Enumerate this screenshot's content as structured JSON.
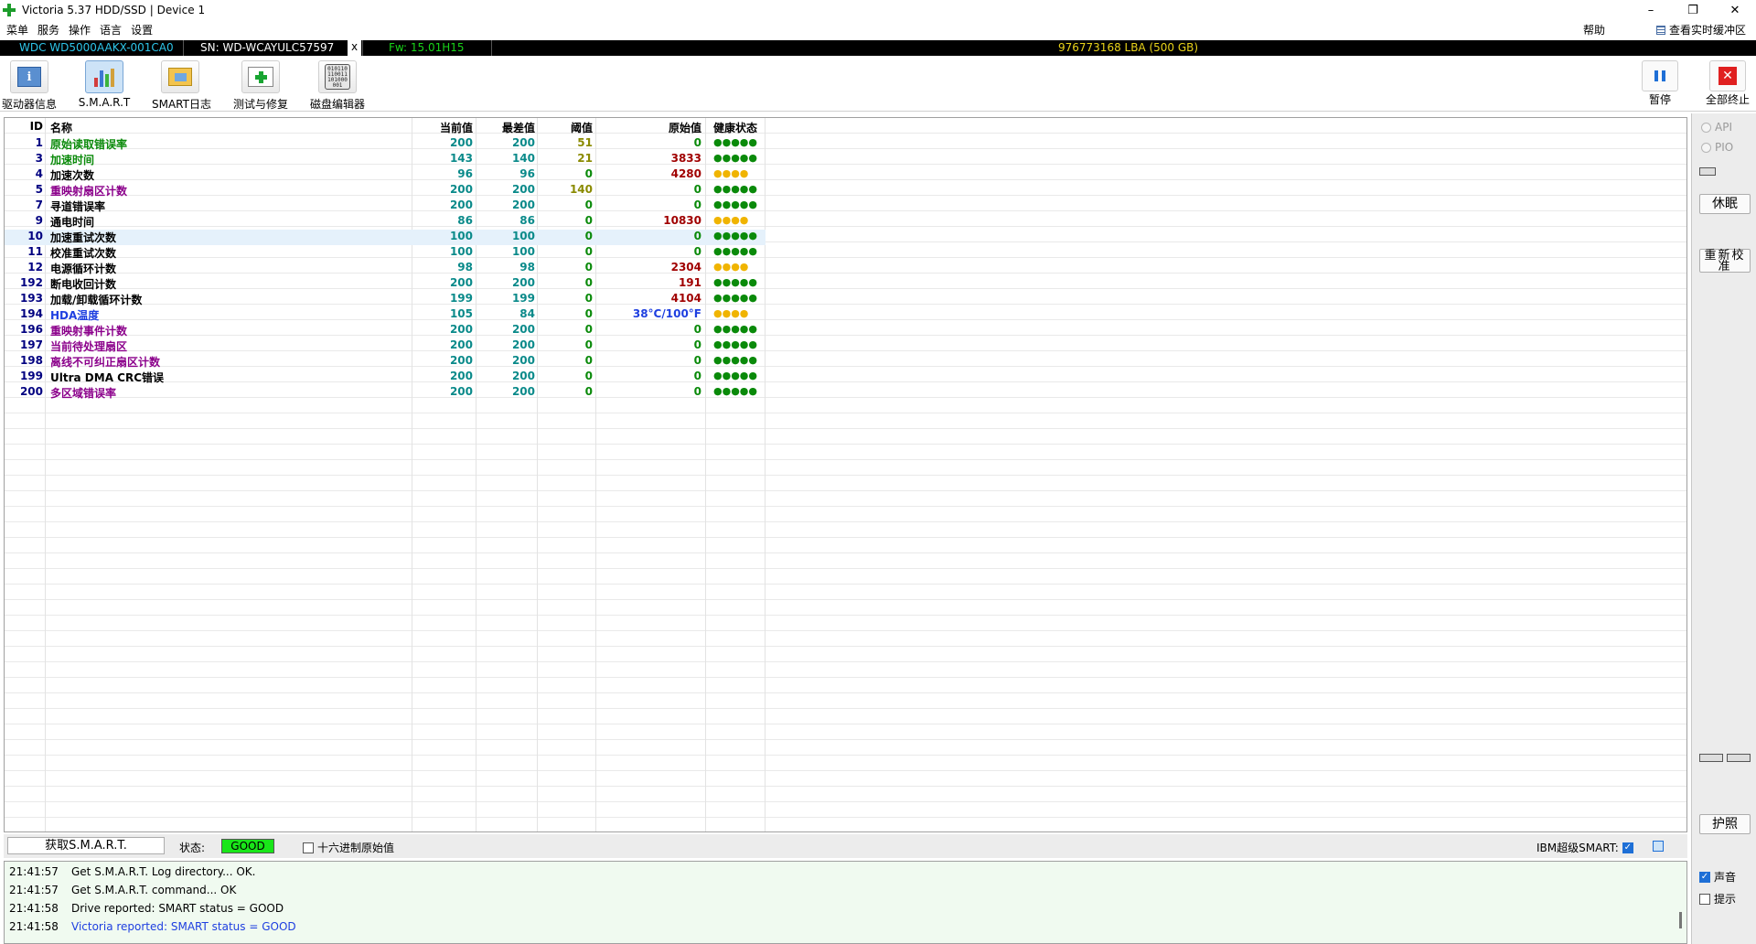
{
  "window": {
    "title": "Victoria 5.37 HDD/SSD | Device 1",
    "controls": [
      "–",
      "❐",
      "✕"
    ]
  },
  "menu": [
    "菜单",
    "服务",
    "操作",
    "语言",
    "设置"
  ],
  "help": "帮助",
  "buffer_link": "查看实时缓冲区",
  "device": {
    "model": "WDC WD5000AAKX-001CA0",
    "serial": "SN: WD-WCAYULC57597",
    "close": "x",
    "firmware": "Fw: 15.01H15",
    "capacity": "976773168 LBA (500 GB)"
  },
  "toolbar": {
    "drive_info": "驱动器信息",
    "smart": "S.M.A.R.T",
    "smart_log": "SMART日志",
    "test_repair": "测试与修复",
    "disk_editor": "磁盘编辑器",
    "disk_editor_icon_text": "010110 110011 101000 001",
    "info_icon_text": "i",
    "pause": "暂停",
    "stop_all": "全部终止",
    "stop_icon_text": "✕"
  },
  "table": {
    "headers": {
      "id": "ID",
      "name": "名称",
      "current": "当前值",
      "worst": "最差值",
      "threshold": "阈值",
      "raw": "原始值",
      "health": "健康状态"
    },
    "rows": [
      {
        "id": "1",
        "name": "原始读取错误率",
        "cur": "200",
        "worst": "200",
        "thr": "51",
        "raw": "0",
        "health": "●●●●●"
      },
      {
        "id": "3",
        "name": "加速时间",
        "cur": "143",
        "worst": "140",
        "thr": "21",
        "raw": "3833",
        "health": "●●●●●"
      },
      {
        "id": "4",
        "name": "加速次数",
        "cur": "96",
        "worst": "96",
        "thr": "0",
        "raw": "4280",
        "health": "●●●●"
      },
      {
        "id": "5",
        "name": "重映射扇区计数",
        "cur": "200",
        "worst": "200",
        "thr": "140",
        "raw": "0",
        "health": "●●●●●"
      },
      {
        "id": "7",
        "name": "寻道错误率",
        "cur": "200",
        "worst": "200",
        "thr": "0",
        "raw": "0",
        "health": "●●●●●"
      },
      {
        "id": "9",
        "name": "通电时间",
        "cur": "86",
        "worst": "86",
        "thr": "0",
        "raw": "10830",
        "health": "●●●●"
      },
      {
        "id": "10",
        "name": "加速重试次数",
        "cur": "100",
        "worst": "100",
        "thr": "0",
        "raw": "0",
        "health": "●●●●●"
      },
      {
        "id": "11",
        "name": "校准重试次数",
        "cur": "100",
        "worst": "100",
        "thr": "0",
        "raw": "0",
        "health": "●●●●●"
      },
      {
        "id": "12",
        "name": "电源循环计数",
        "cur": "98",
        "worst": "98",
        "thr": "0",
        "raw": "2304",
        "health": "●●●●"
      },
      {
        "id": "192",
        "name": "断电收回计数",
        "cur": "200",
        "worst": "200",
        "thr": "0",
        "raw": "191",
        "health": "●●●●●"
      },
      {
        "id": "193",
        "name": "加载/卸载循环计数",
        "cur": "199",
        "worst": "199",
        "thr": "0",
        "raw": "4104",
        "health": "●●●●●"
      },
      {
        "id": "194",
        "name": "HDA温度",
        "cur": "105",
        "worst": "84",
        "thr": "0",
        "raw": "38°C/100°F",
        "health": "●●●●"
      },
      {
        "id": "196",
        "name": "重映射事件计数",
        "cur": "200",
        "worst": "200",
        "thr": "0",
        "raw": "0",
        "health": "●●●●●"
      },
      {
        "id": "197",
        "name": "当前待处理扇区",
        "cur": "200",
        "worst": "200",
        "thr": "0",
        "raw": "0",
        "health": "●●●●●"
      },
      {
        "id": "198",
        "name": "离线不可纠正扇区计数",
        "cur": "200",
        "worst": "200",
        "thr": "0",
        "raw": "0",
        "health": "●●●●●"
      },
      {
        "id": "199",
        "name": "Ultra DMA CRC错误",
        "cur": "200",
        "worst": "200",
        "thr": "0",
        "raw": "0",
        "health": "●●●●●"
      },
      {
        "id": "200",
        "name": "多区域错误率",
        "cur": "200",
        "worst": "200",
        "thr": "0",
        "raw": "0",
        "health": "●●●●●"
      }
    ]
  },
  "side": {
    "api": "API",
    "pio": "PIO",
    "sleep": "休眠",
    "recalibrate": "重新校准",
    "passport": "护照",
    "sound": "声音",
    "hints": "提示"
  },
  "status": {
    "get_smart": "获取S.M.A.R.T.",
    "state_label": "状态:",
    "state_value": "GOOD",
    "hex_raw": "十六进制原始值",
    "ibm_smart": "IBM超级SMART:"
  },
  "log": [
    {
      "time": "21:41:57",
      "msg": "Get S.M.A.R.T. Log directory... OK."
    },
    {
      "time": "21:41:57",
      "msg": "Get S.M.A.R.T. command... OK"
    },
    {
      "time": "21:41:58",
      "msg": "Drive reported: SMART status = GOOD"
    },
    {
      "time": "21:41:58",
      "msg": "Victoria reported: SMART status = GOOD"
    }
  ],
  "colors": {
    "good_status": "#19e619",
    "health_green": "#0a8a0a",
    "health_yellow": "#f0b400",
    "raw_red": "#a00000",
    "id_navy": "#000080"
  }
}
